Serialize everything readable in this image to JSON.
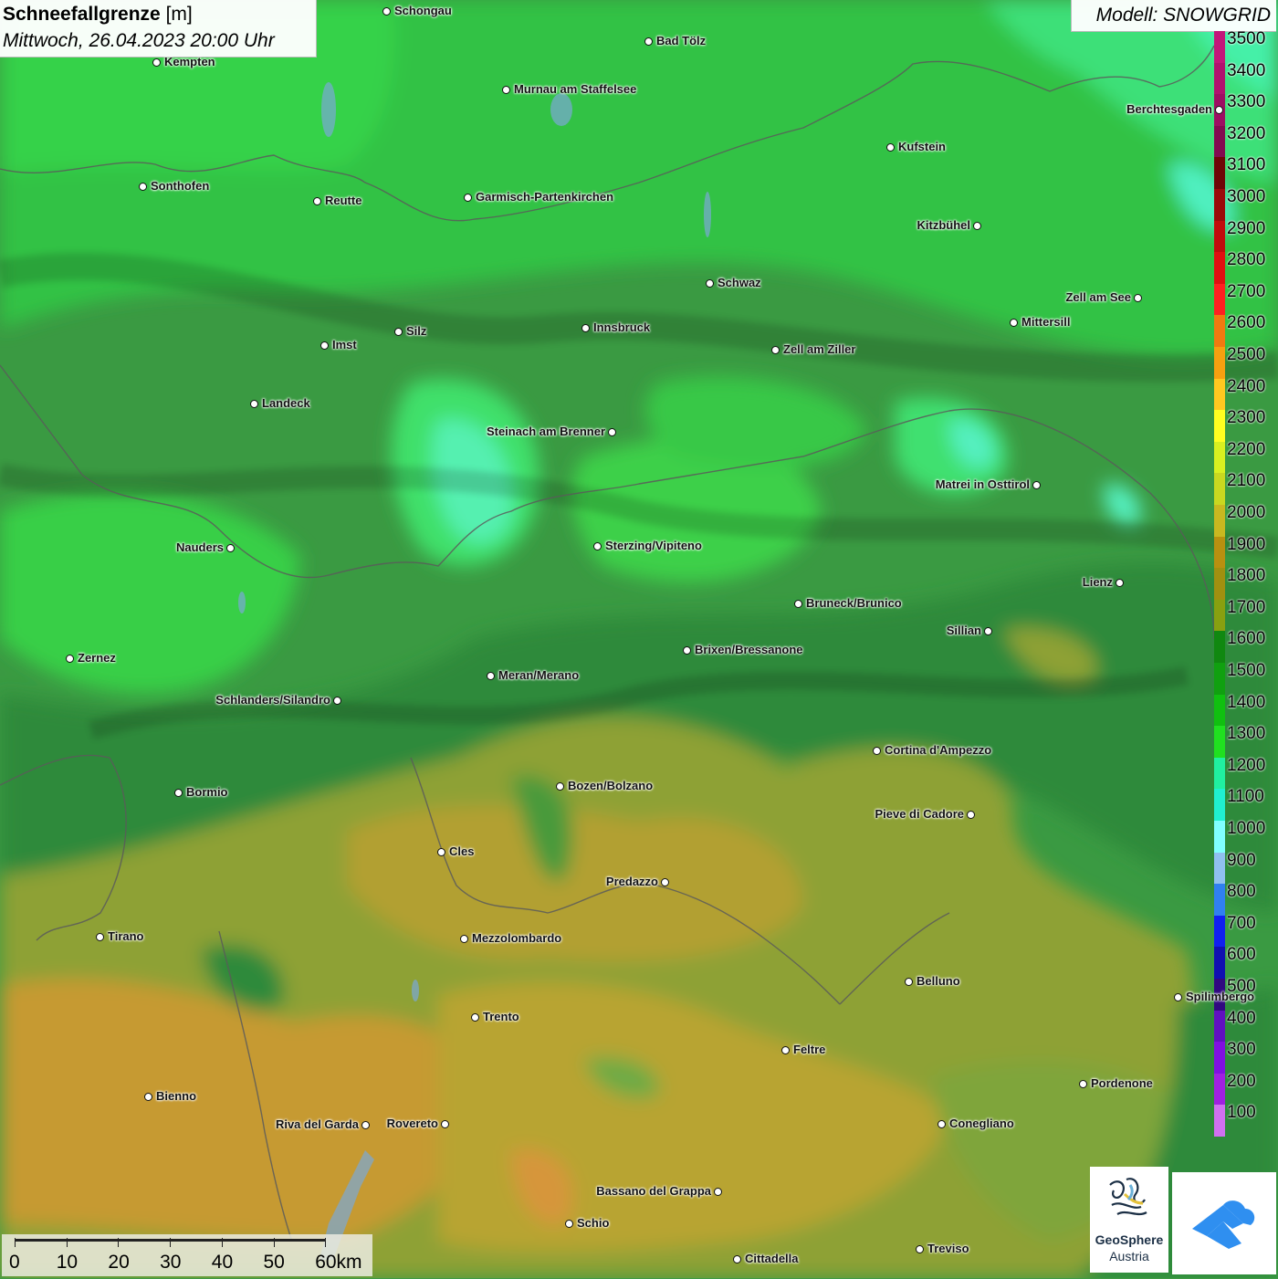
{
  "header": {
    "title_bold": "Schneefallgrenze",
    "title_unit": "[m]",
    "subtitle": "Mittwoch, 26.04.2023 20:00 Uhr",
    "model": "Modell: SNOWGRID"
  },
  "legend": [
    {
      "label": "3500",
      "color": "#c2177a"
    },
    {
      "label": "3400",
      "color": "#b0126e"
    },
    {
      "label": "3300",
      "color": "#9c0f62"
    },
    {
      "label": "3200",
      "color": "#820b50"
    },
    {
      "label": "3100",
      "color": "#6e0606"
    },
    {
      "label": "3000",
      "color": "#9a0a0a"
    },
    {
      "label": "2900",
      "color": "#c00c0c"
    },
    {
      "label": "2800",
      "color": "#e01010"
    },
    {
      "label": "2700",
      "color": "#ff2020"
    },
    {
      "label": "2600",
      "color": "#f07a10"
    },
    {
      "label": "2500",
      "color": "#f5a010"
    },
    {
      "label": "2400",
      "color": "#ffc820"
    },
    {
      "label": "2300",
      "color": "#ffff20"
    },
    {
      "label": "2200",
      "color": "#d8f020"
    },
    {
      "label": "2100",
      "color": "#c8d820"
    },
    {
      "label": "2000",
      "color": "#c8b820"
    },
    {
      "label": "1900",
      "color": "#b89010"
    },
    {
      "label": "1800",
      "color": "#a09010"
    },
    {
      "label": "1700",
      "color": "#88a010"
    },
    {
      "label": "1600",
      "color": "#108810"
    },
    {
      "label": "1500",
      "color": "#10a010"
    },
    {
      "label": "1400",
      "color": "#10c010"
    },
    {
      "label": "1300",
      "color": "#20e020"
    },
    {
      "label": "1200",
      "color": "#20f0a0"
    },
    {
      "label": "1100",
      "color": "#20f0d0"
    },
    {
      "label": "1000",
      "color": "#80ffff"
    },
    {
      "label": "900",
      "color": "#90c0f0"
    },
    {
      "label": "800",
      "color": "#3080f0"
    },
    {
      "label": "700",
      "color": "#1020f0"
    },
    {
      "label": "600",
      "color": "#1010b0"
    },
    {
      "label": "500",
      "color": "#300880"
    },
    {
      "label": "400",
      "color": "#6010c0"
    },
    {
      "label": "300",
      "color": "#8010e0"
    },
    {
      "label": "200",
      "color": "#a020e0"
    },
    {
      "label": "100",
      "color": "#d070f0"
    }
  ],
  "cities": [
    {
      "name": "Schongau",
      "side": "right"
    },
    {
      "name": "Bad Tölz",
      "side": "right"
    },
    {
      "name": "Kempten",
      "side": "right"
    },
    {
      "name": "Murnau am Staffelsee",
      "side": "right"
    },
    {
      "name": "Berchtesgaden",
      "side": "left"
    },
    {
      "name": "Kufstein",
      "side": "right"
    },
    {
      "name": "Sonthofen",
      "side": "right"
    },
    {
      "name": "Reutte",
      "side": "right"
    },
    {
      "name": "Garmisch-Partenkirchen",
      "side": "right"
    },
    {
      "name": "Kitzbühel",
      "side": "left"
    },
    {
      "name": "Schwaz",
      "side": "right"
    },
    {
      "name": "Zell am See",
      "side": "left"
    },
    {
      "name": "Innsbruck",
      "side": "right"
    },
    {
      "name": "Mittersill",
      "side": "right"
    },
    {
      "name": "Silz",
      "side": "right"
    },
    {
      "name": "Imst",
      "side": "right"
    },
    {
      "name": "Zell am Ziller",
      "side": "right"
    },
    {
      "name": "Landeck",
      "side": "right"
    },
    {
      "name": "Steinach am Brenner",
      "side": "left"
    },
    {
      "name": "Matrei in Osttirol",
      "side": "left"
    },
    {
      "name": "Nauders",
      "side": "left"
    },
    {
      "name": "Sterzing/Vipiteno",
      "side": "right"
    },
    {
      "name": "Lienz",
      "side": "left"
    },
    {
      "name": "Bruneck/Brunico",
      "side": "right"
    },
    {
      "name": "Sillian",
      "side": "left"
    },
    {
      "name": "Zernez",
      "side": "right"
    },
    {
      "name": "Brixen/Bressanone",
      "side": "right"
    },
    {
      "name": "Meran/Merano",
      "side": "right"
    },
    {
      "name": "Schlanders/Silandro",
      "side": "left"
    },
    {
      "name": "Cortina d'Ampezzo",
      "side": "right"
    },
    {
      "name": "Bozen/Bolzano",
      "side": "right"
    },
    {
      "name": "Bormio",
      "side": "right"
    },
    {
      "name": "Pieve di Cadore",
      "side": "left"
    },
    {
      "name": "Cles",
      "side": "right"
    },
    {
      "name": "Predazzo",
      "side": "left"
    },
    {
      "name": "Tirano",
      "side": "right"
    },
    {
      "name": "Mezzolombardo",
      "side": "right"
    },
    {
      "name": "Belluno",
      "side": "right"
    },
    {
      "name": "Spilimbergo",
      "side": "right"
    },
    {
      "name": "Trento",
      "side": "right"
    },
    {
      "name": "Feltre",
      "side": "right"
    },
    {
      "name": "Pordenone",
      "side": "right"
    },
    {
      "name": "Bienno",
      "side": "right"
    },
    {
      "name": "Riva del Garda",
      "side": "left"
    },
    {
      "name": "Rovereto",
      "side": "left"
    },
    {
      "name": "Conegliano",
      "side": "right"
    },
    {
      "name": "Bassano del Grappa",
      "side": "left"
    },
    {
      "name": "Schio",
      "side": "right"
    },
    {
      "name": "Treviso",
      "side": "right"
    },
    {
      "name": "Cittadella",
      "side": "right"
    }
  ],
  "scale": {
    "labels": [
      "0",
      "10",
      "20",
      "30",
      "40",
      "50",
      "60km"
    ]
  },
  "logos": {
    "geosphere_name": "GeoSphere",
    "geosphere_sub": "Austria"
  }
}
